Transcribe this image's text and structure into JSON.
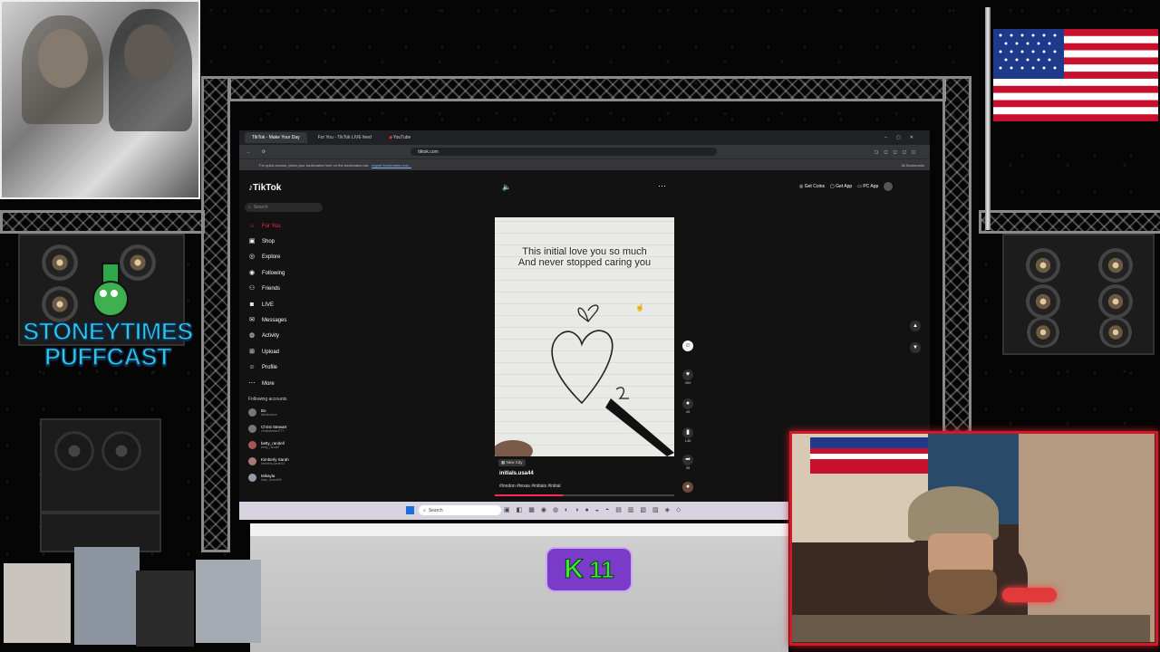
{
  "stream": {
    "logo_line1": "STONEYTIMES",
    "logo_line2": "PUFFCAST",
    "badge_text": "11",
    "accent_green": "#39e639",
    "accent_purple": "#7a3cc8"
  },
  "browser": {
    "tabs": [
      {
        "label": "TikTok - Make Your Day"
      },
      {
        "label": "For You - TikTok LIVE feed"
      },
      {
        "label": "YouTube"
      }
    ],
    "url": "tiktok.com",
    "bookmark_hint": "For quick access, place your bookmarks here on the bookmarks bar.",
    "bookmark_link": "Import bookmarks now...",
    "all_bookmarks": "All Bookmarks"
  },
  "tiktok": {
    "brand": "TikTok",
    "search_placeholder": "Search",
    "nav": [
      {
        "label": "For You",
        "icon": "home-icon",
        "active": true
      },
      {
        "label": "Shop",
        "icon": "shop-icon"
      },
      {
        "label": "Explore",
        "icon": "compass-icon"
      },
      {
        "label": "Following",
        "icon": "following-icon"
      },
      {
        "label": "Friends",
        "icon": "friends-icon"
      },
      {
        "label": "LIVE",
        "icon": "live-icon"
      },
      {
        "label": "Messages",
        "icon": "messages-icon"
      },
      {
        "label": "Activity",
        "icon": "activity-icon"
      },
      {
        "label": "Upload",
        "icon": "upload-icon"
      },
      {
        "label": "Profile",
        "icon": "profile-icon"
      },
      {
        "label": "More",
        "icon": "more-icon"
      }
    ],
    "following_header": "Following accounts",
    "accounts": [
      {
        "name": "Bo",
        "handle": "itsbobarlow"
      },
      {
        "name": "Christ Stewart",
        "handle": "christstewart777"
      },
      {
        "name": "betty_randell",
        "handle": "betty_randell"
      },
      {
        "name": "Kimberly Sarah",
        "handle": "kimberly.sarah15"
      },
      {
        "name": "Mikayla",
        "handle": "bliss_bean995"
      }
    ],
    "top_right": {
      "coins": "Get Coins",
      "app": "Get App",
      "pc_app": "PC App"
    },
    "video": {
      "caption_line1": "This initial love you so much",
      "caption_line2": "And never stopped caring you",
      "location": "New City",
      "author": "initials.usa44",
      "hashtags": "#london #texas #initials #initial",
      "likes": "499",
      "comments": "45",
      "saves": "146",
      "shares": "39"
    }
  },
  "taskbar": {
    "search_label": "Search"
  }
}
